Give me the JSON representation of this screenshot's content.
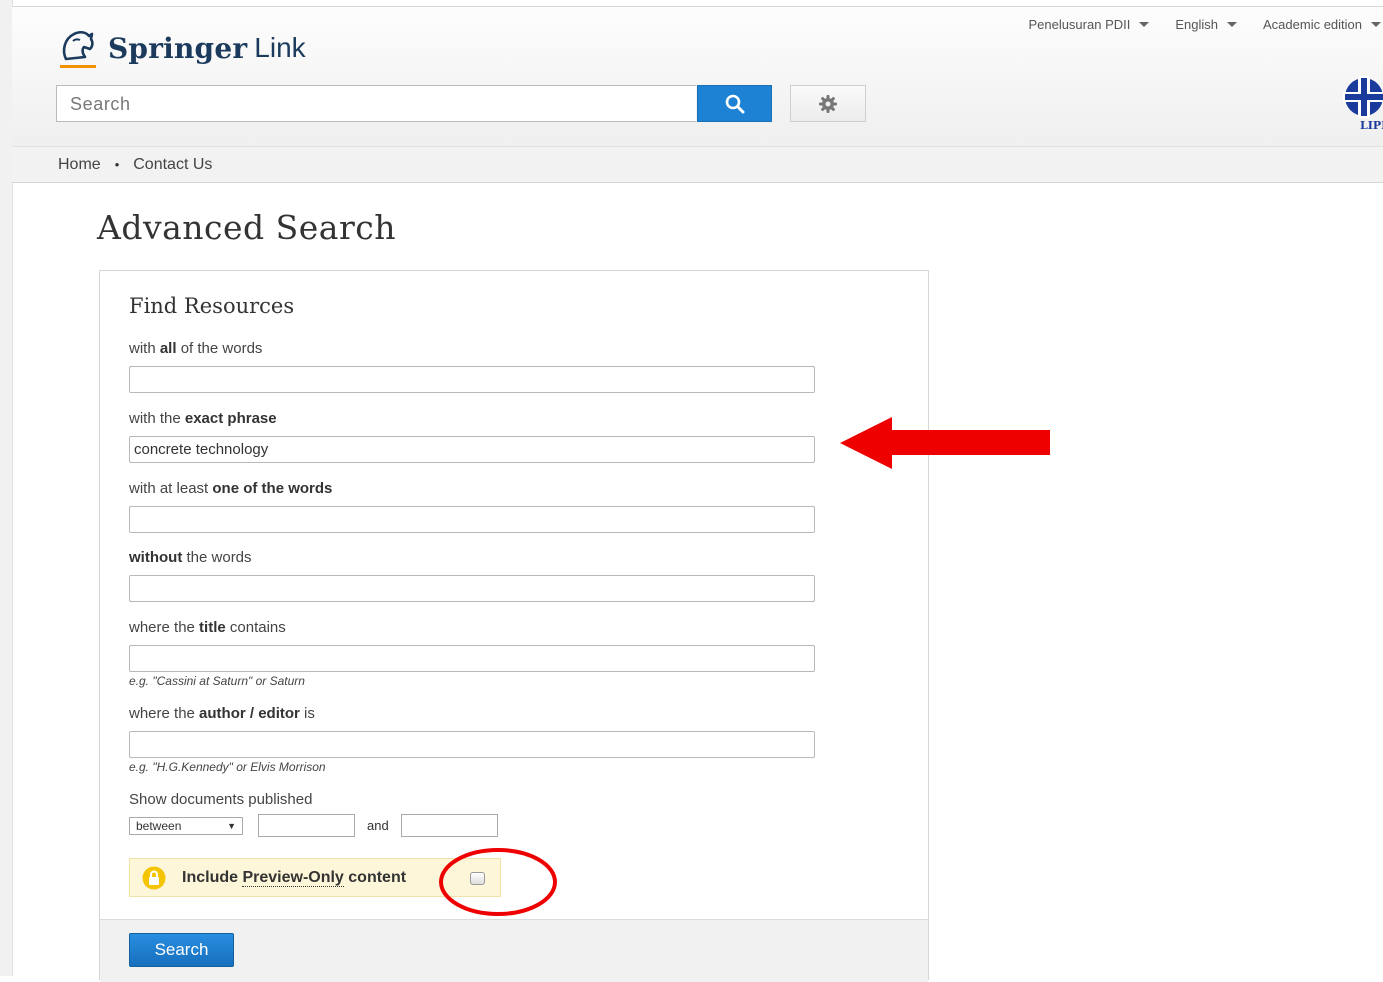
{
  "brand": {
    "name_bold": "Springer",
    "name_light": "Link",
    "accent": "#f39200"
  },
  "header": {
    "top_links": [
      {
        "label": "Penelusuran PDII"
      },
      {
        "label": "English"
      },
      {
        "label": "Academic edition"
      }
    ],
    "search": {
      "placeholder": "Search"
    },
    "institution_logo_text": "LIPI"
  },
  "nav": {
    "items": [
      "Home",
      "Contact Us"
    ],
    "separator": "•"
  },
  "page": {
    "title": "Advanced Search"
  },
  "form": {
    "title": "Find Resources",
    "all_words": {
      "pre": "with ",
      "bold": "all",
      "post": " of the words",
      "value": ""
    },
    "exact_phrase": {
      "pre": "with the ",
      "bold": "exact phrase",
      "post": "",
      "value": "concrete technology"
    },
    "one_of": {
      "pre": "with at least ",
      "bold": "one of the words",
      "post": "",
      "value": ""
    },
    "without": {
      "pre": "",
      "bold": "without",
      "post": " the words",
      "value": ""
    },
    "title_contains": {
      "pre": "where the ",
      "bold": "title",
      "post": " contains",
      "value": "",
      "hint": "e.g. \"Cassini at Saturn\" or Saturn"
    },
    "author": {
      "pre": "where the ",
      "bold": "author / editor",
      "post": " is",
      "value": "",
      "hint": "e.g. \"H.G.Kennedy\" or Elvis Morrison"
    },
    "published": {
      "label": "Show documents published",
      "mode": "between",
      "and_label": "and",
      "start_year": "",
      "end_year": ""
    },
    "preview": {
      "pre": "Include ",
      "dotted": "Preview-Only",
      "post": " content",
      "checked": false
    },
    "submit_label": "Search"
  },
  "colors": {
    "primary_button": "#1e82d4",
    "annotation": "#ee0000",
    "preview_bg": "#fdf6d9"
  }
}
